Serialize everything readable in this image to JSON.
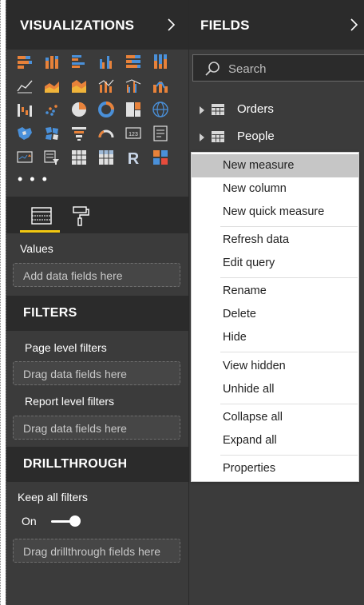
{
  "visualizations_pane": {
    "title": "VISUALIZATIONS",
    "icons": [
      "stacked-bar-icon",
      "stacked-column-icon",
      "clustered-bar-icon",
      "clustered-column-icon",
      "100-bar-icon",
      "100-column-icon",
      "line-chart-icon",
      "area-chart-icon",
      "stacked-area-icon",
      "line-column-icon",
      "line-clustered-column-icon",
      "ribbon-chart-icon",
      "waterfall-icon",
      "scatter-icon",
      "pie-icon",
      "donut-icon",
      "treemap-icon",
      "globe-map-icon",
      "filled-map-icon",
      "shape-map-icon",
      "funnel-icon",
      "gauge-icon",
      "card-icon",
      "multi-row-card-icon",
      "kpi-icon",
      "slicer-icon",
      "table-icon",
      "matrix-icon",
      "r-visual-icon",
      "custom-visual-icon"
    ],
    "more": "• • •",
    "values_label": "Values",
    "values_placeholder": "Add data fields here"
  },
  "filters": {
    "header": "FILTERS",
    "page_label": "Page level filters",
    "page_placeholder": "Drag data fields here",
    "report_label": "Report level filters",
    "report_placeholder": "Drag data fields here"
  },
  "drillthrough": {
    "header": "DRILLTHROUGH",
    "keep_label": "Keep all filters",
    "toggle_label": "On",
    "toggle_on": true,
    "placeholder": "Drag drillthrough fields here"
  },
  "fields_pane": {
    "title": "FIELDS",
    "search_placeholder": "Search",
    "tables": [
      "Orders",
      "People"
    ]
  },
  "context_menu": {
    "items": [
      {
        "label": "New measure",
        "highlighted": true
      },
      {
        "label": "New column"
      },
      {
        "label": "New quick measure"
      },
      {
        "label": "Refresh data"
      },
      {
        "label": "Edit query"
      },
      {
        "label": "Rename"
      },
      {
        "label": "Delete"
      },
      {
        "label": "Hide"
      },
      {
        "label": "View hidden"
      },
      {
        "label": "Unhide all"
      },
      {
        "label": "Collapse all"
      },
      {
        "label": "Expand all"
      },
      {
        "label": "Properties"
      }
    ]
  },
  "colors": {
    "pane_bg": "#3b3b3b",
    "header_bg": "#2b2b2b",
    "accent_yellow": "#f2c811",
    "icon_orange": "#e8823a",
    "icon_blue": "#4a90d9",
    "menu_highlight": "#c6c6c6"
  }
}
